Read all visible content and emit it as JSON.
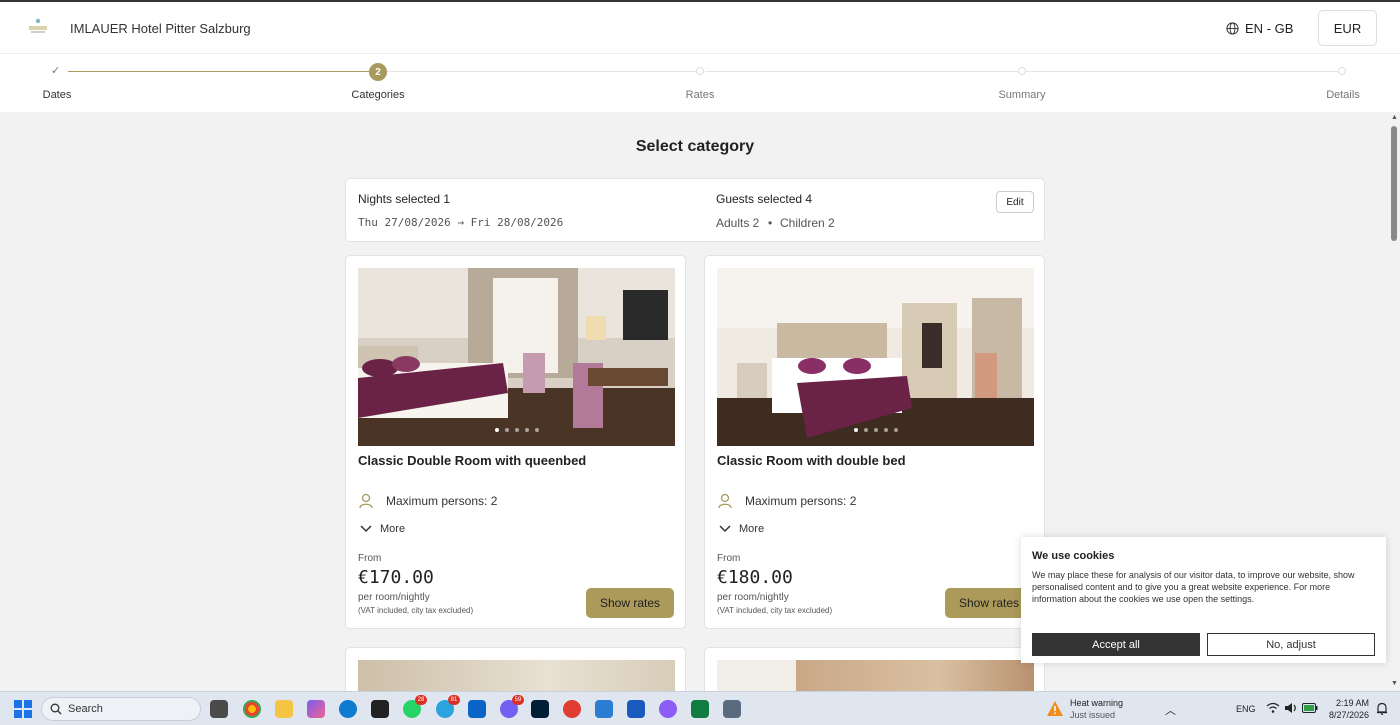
{
  "header": {
    "hotel_name": "IMLAUER Hotel Pitter Salzburg",
    "language": "EN - GB",
    "currency": "EUR"
  },
  "stepper": {
    "steps": [
      {
        "label": "Dates",
        "state": "done"
      },
      {
        "label": "Categories",
        "state": "active",
        "number": "2"
      },
      {
        "label": "Rates",
        "state": "todo"
      },
      {
        "label": "Summary",
        "state": "todo"
      },
      {
        "label": "Details",
        "state": "todo"
      }
    ]
  },
  "page_title": "Select category",
  "summary": {
    "nights_label": "Nights selected 1",
    "dates": "Thu 27/08/2026 → Fri 28/08/2026",
    "guests_label": "Guests selected 4",
    "adults": "Adults 2",
    "children": "Children 2",
    "separator": "•",
    "edit_label": "Edit"
  },
  "rooms": [
    {
      "name": "Classic Double Room with queenbed",
      "max_persons": "Maximum persons: 2",
      "more_label": "More",
      "from_label": "From",
      "price": "€170.00",
      "per_label": "per room/nightly",
      "vat_label": "(VAT included, city tax excluded)",
      "button_label": "Show rates"
    },
    {
      "name": "Classic Room with double bed",
      "max_persons": "Maximum persons: 2",
      "more_label": "More",
      "from_label": "From",
      "price": "€180.00",
      "per_label": "per room/nightly",
      "vat_label": "(VAT included, city tax excluded)",
      "button_label": "Show rates"
    }
  ],
  "cookie": {
    "title": "We use cookies",
    "text": "We may place these for analysis of our visitor data, to improve our website, show personalised content and to give you a great website experience. For more information about the cookies we use open the settings.",
    "accept_label": "Accept all",
    "adjust_label": "No, adjust"
  },
  "taskbar": {
    "search_label": "Search",
    "badge_whatsapp": "28",
    "badge_telegram": "81",
    "badge_viber": "59",
    "weather_title": "Heat warning",
    "weather_sub": "Just issued",
    "lang": "ENG",
    "time": "2:19 AM",
    "date": "8/27/2026"
  },
  "colors": {
    "accent": "#ab9a5a",
    "dark_button": "#333333"
  }
}
